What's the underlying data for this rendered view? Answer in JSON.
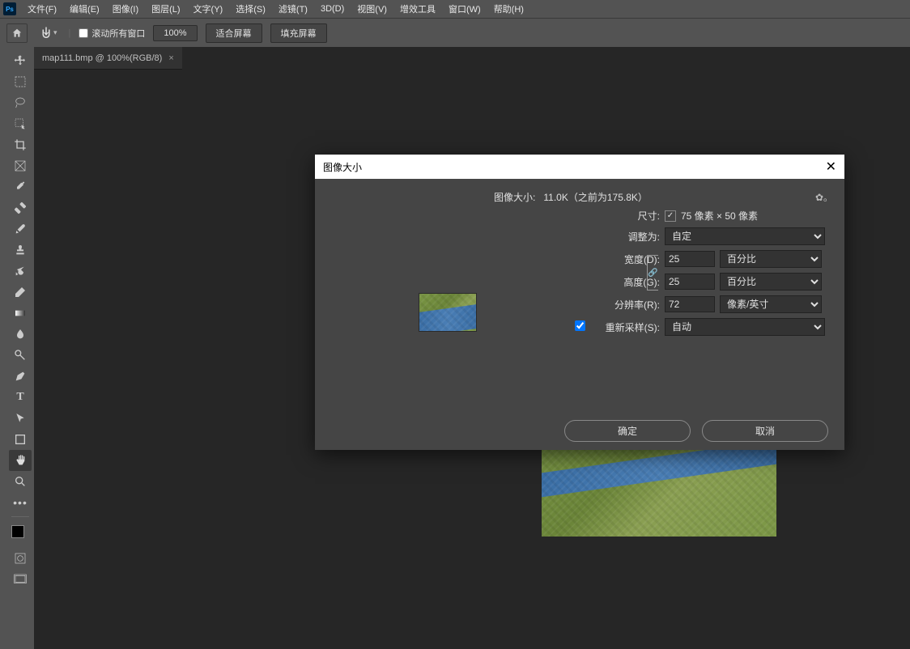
{
  "menu": {
    "items": [
      "文件(F)",
      "编辑(E)",
      "图像(I)",
      "图层(L)",
      "文字(Y)",
      "选择(S)",
      "滤镜(T)",
      "3D(D)",
      "视图(V)",
      "增效工具",
      "窗口(W)",
      "帮助(H)"
    ]
  },
  "options": {
    "scroll_all": "滚动所有窗口",
    "zoom": "100%",
    "fit": "适合屏幕",
    "fill": "填充屏幕"
  },
  "tab": {
    "label": "map111.bmp @ 100%(RGB/8)"
  },
  "dialog": {
    "title": "图像大小",
    "size_label": "图像大小:",
    "size_value": "11.0K（之前为175.8K）",
    "dim_label": "尺寸:",
    "dim_value": "75 像素 × 50 像素",
    "fit_label": "调整为:",
    "fit_value": "自定",
    "width_label": "宽度(D):",
    "width_value": "25",
    "width_unit": "百分比",
    "height_label": "高度(G):",
    "height_value": "25",
    "height_unit": "百分比",
    "res_label": "分辨率(R):",
    "res_value": "72",
    "res_unit": "像素/英寸",
    "resample_label": "重新采样(S):",
    "resample_value": "自动",
    "ok": "确定",
    "cancel": "取消"
  }
}
